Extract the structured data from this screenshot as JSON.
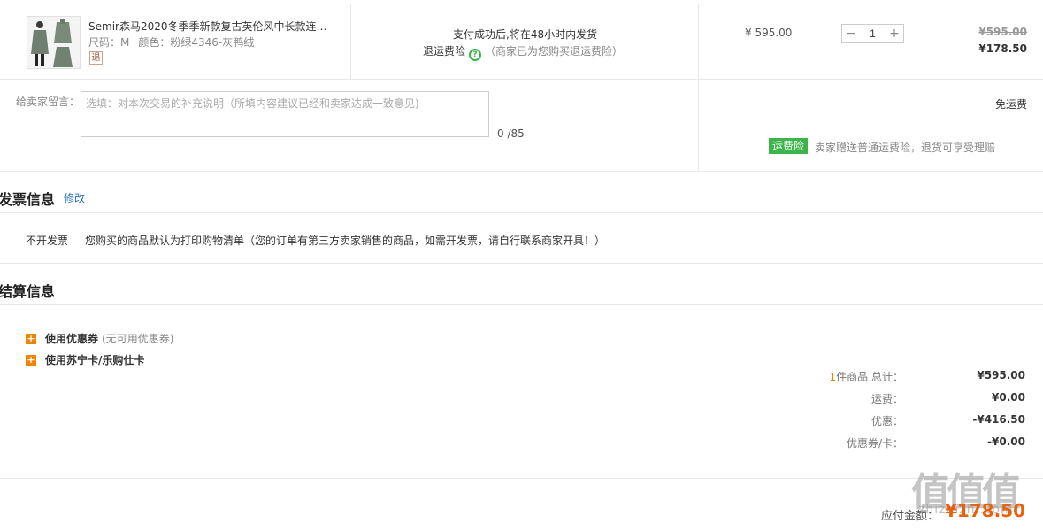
{
  "product": {
    "title": "Semir森马2020冬季季新款复古英伦风中长款连帽…",
    "size_label": "尺码：M",
    "color_label": "颜色：粉绿4346-灰鸭绒",
    "return_badge": "退",
    "ship_note": "支付成功后,将在48小时内发货",
    "insurance_label": "退运费险",
    "insurance_note": "（商家已为您购买退运费险）",
    "unit_price": "¥ 595.00",
    "quantity": "1",
    "minus": "−",
    "plus": "+",
    "original_price": "¥595.00",
    "final_price": "¥178.50"
  },
  "message": {
    "label": "给卖家留言：",
    "placeholder": "选填：对本次交易的补充说明（所填内容建议已经和卖家达成一致意见)",
    "count": "0 /85",
    "free_shipping": "免运费",
    "insurance_tag": "运费险",
    "insurance_desc": "卖家赠送普通运费险，退货可享受理赔"
  },
  "invoice": {
    "title": "发票信息",
    "edit_label": "修改",
    "type": "不开发票",
    "note": "您购买的商品默认为打印购物清单（您的订单有第三方卖家销售的商品，如需开发票，请自行联系商家开具！）"
  },
  "settlement": {
    "title": "结算信息",
    "coupon_label": "使用优惠券",
    "coupon_hint": "(无可用优惠券)",
    "card_label": "使用苏宁卡/乐购仕卡",
    "item_count": "1",
    "total_label_suffix": "件商品 总计：",
    "total_value": "¥595.00",
    "shipping_label": "运费：",
    "shipping_value": "¥0.00",
    "discount_label": "优惠：",
    "discount_value": "-¥416.50",
    "coupon_card_label": "优惠券/卡：",
    "coupon_card_value": "-¥0.00",
    "pay_label": "应付金额：",
    "pay_amount": "¥178.50"
  },
  "watermark": {
    "main": "值值值",
    "sub": "zhizhizhi.com"
  },
  "colors": {
    "accent_orange": "#f08300",
    "pay_orange": "#e8610c",
    "insurance_green": "#3bb44a",
    "link_blue": "#2a6ebb"
  }
}
